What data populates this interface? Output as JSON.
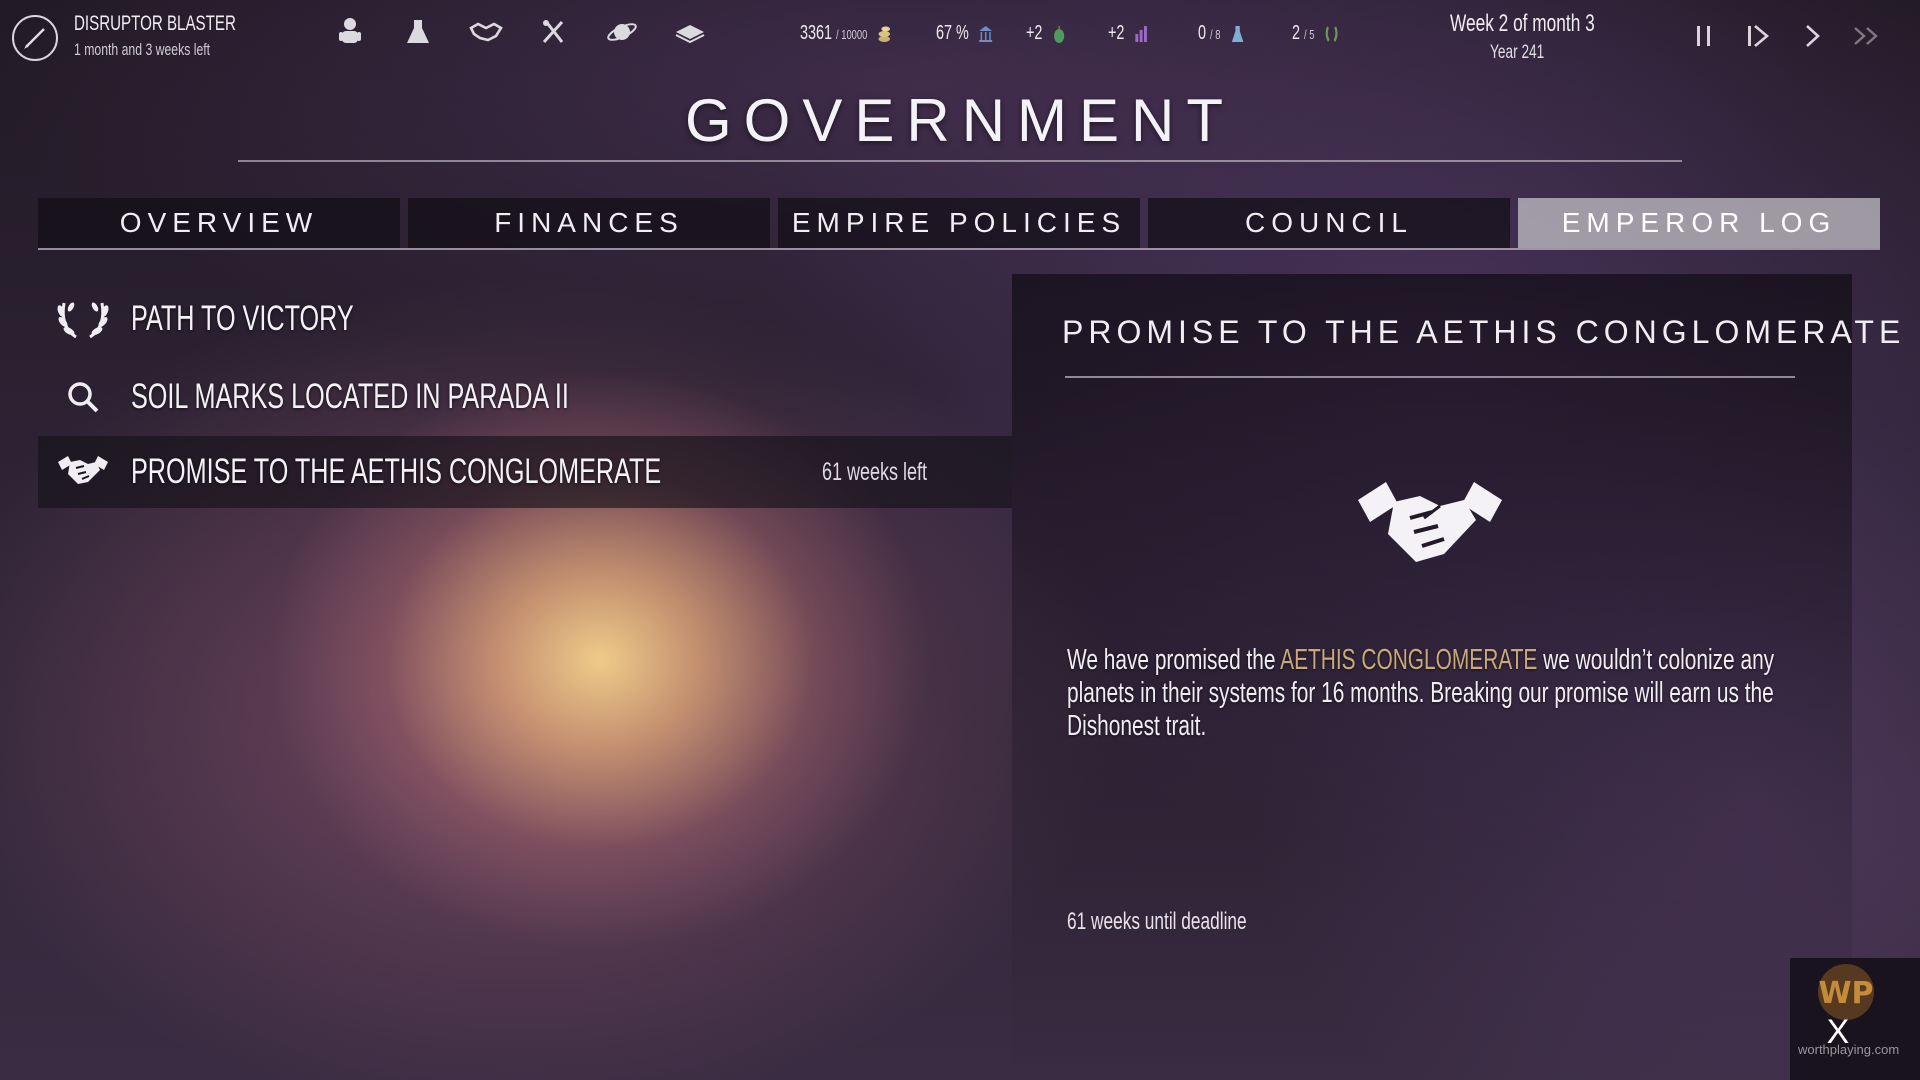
{
  "topbar": {
    "weapon": {
      "name": "DISRUPTOR BLASTER",
      "time_left": "1 month and 3 weeks left",
      "icon": "pen-icon"
    },
    "menu_icons": [
      "species-icon",
      "research-flask-icon",
      "diplomacy-handshake-icon",
      "ships-tools-icon",
      "planet-icon",
      "empire-book-icon"
    ],
    "resources": {
      "credits": {
        "value": "3361",
        "max": "/ 10000",
        "icon": "coins-icon"
      },
      "approval": {
        "value": "67 %",
        "icon": "government-building-icon"
      },
      "food": {
        "value": "+2",
        "icon": "apple-icon"
      },
      "industry": {
        "value": "+2",
        "icon": "industry-bars-icon"
      },
      "research": {
        "value": "0",
        "max": "/ 8",
        "icon": "flask-icon"
      },
      "influence": {
        "value": "2",
        "max": "/ 5",
        "icon": "laurel-icon"
      }
    },
    "date": {
      "line1": "Week 2 of month 3",
      "line2": "Year 241"
    },
    "speed_controls": [
      "pause-icon",
      "step-icon",
      "play-icon",
      "fast-forward-icon"
    ]
  },
  "page": {
    "title": "GOVERNMENT"
  },
  "tabs": [
    {
      "label": "OVERVIEW",
      "active": false
    },
    {
      "label": "FINANCES",
      "active": false
    },
    {
      "label": "EMPIRE POLICIES",
      "active": false
    },
    {
      "label": "COUNCIL",
      "active": false
    },
    {
      "label": "EMPEROR LOG",
      "active": true
    }
  ],
  "log": [
    {
      "label": "PATH TO VICTORY",
      "icon": "laurel-wreath-icon",
      "time": ""
    },
    {
      "label": "SOIL MARKS LOCATED IN PARADA II",
      "icon": "magnifier-icon",
      "time": ""
    },
    {
      "label": "PROMISE TO THE AETHIS CONGLOMERATE",
      "icon": "handshake-icon",
      "time": "61 weeks left",
      "selected": true
    }
  ],
  "detail": {
    "title": "PROMISE TO THE AETHIS CONGLOMERATE",
    "icon": "handshake-icon",
    "text_before": "We have promised the ",
    "text_highlight": "AETHIS CONGLOMERATE",
    "text_after": " we wouldn’t colonize any planets in their systems for 16 months. Breaking our promise will earn us the Dishonest trait.",
    "deadline": "61 weeks until deadline"
  },
  "watermark": {
    "text": "worthplaying.com"
  },
  "close": {
    "label": "X"
  },
  "colors": {
    "highlight": "#c9a977",
    "active_tab": "#c8c6cc",
    "panel": "#100c14"
  }
}
